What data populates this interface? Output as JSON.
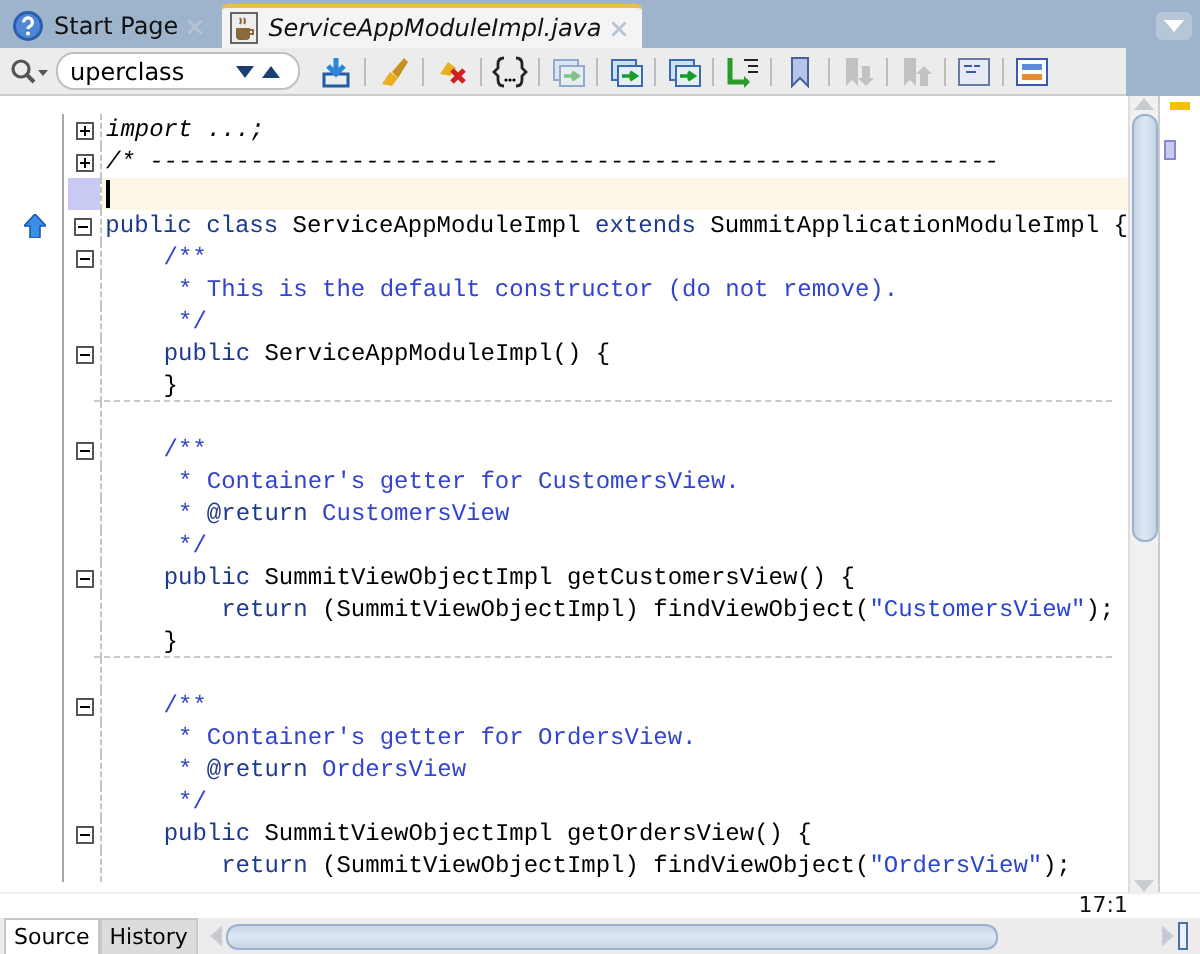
{
  "tabs": [
    {
      "label": "Start Page",
      "selected": false
    },
    {
      "label": "ServiceAppModuleImpl.java",
      "selected": true
    }
  ],
  "toolbar": {
    "search_value": "uperclass",
    "buttons": [
      {
        "disabled": false
      },
      {
        "disabled": false
      },
      {
        "disabled": false
      },
      {
        "disabled": false
      },
      {
        "disabled": true
      },
      {
        "disabled": false
      },
      {
        "disabled": false
      },
      {
        "disabled": false
      },
      {
        "disabled": false
      },
      {
        "disabled": true
      },
      {
        "disabled": true
      },
      {
        "disabled": false
      },
      {
        "disabled": false
      }
    ]
  },
  "code_lines": [
    {
      "kind": "folded",
      "expanded": false,
      "text": "import ...;"
    },
    {
      "kind": "folded",
      "expanded": false,
      "text": "/* -----------------------------------------------------------"
    },
    {
      "current": true
    },
    {
      "kind": "code",
      "expanded": true,
      "overrides": true,
      "text": "**public class** ServiceAppModuleImpl **extends** SummitApplicationModuleImpl {"
    },
    {
      "kind": "comment",
      "expanded": true,
      "text": "    /**"
    },
    {
      "kind": "comment",
      "text": "     * This is the default constructor (do not remove)."
    },
    {
      "kind": "comment",
      "text": "     */"
    },
    {
      "kind": "code",
      "expanded": true,
      "text": "    **public** ServiceAppModuleImpl() {"
    },
    {
      "kind": "code",
      "text": "    }"
    },
    {
      "separator": true
    },
    {
      "kind": "comment",
      "expanded": true,
      "text": "    /**"
    },
    {
      "kind": "comment",
      "text": "     * Container's getter for CustomersView."
    },
    {
      "kind": "comment",
      "text": "     * **@return** CustomersView"
    },
    {
      "kind": "comment",
      "text": "     */"
    },
    {
      "kind": "code",
      "expanded": true,
      "text": "    **public** SummitViewObjectImpl getCustomersView() {"
    },
    {
      "kind": "code",
      "text": "        **return** (SummitViewObjectImpl) findViewObject(*\"CustomersView\"*);"
    },
    {
      "kind": "code",
      "text": "    }"
    },
    {
      "separator": true
    },
    {
      "kind": "comment",
      "expanded": true,
      "text": "    /**"
    },
    {
      "kind": "comment",
      "text": "     * Container's getter for OrdersView."
    },
    {
      "kind": "comment",
      "text": "     * **@return** OrdersView"
    },
    {
      "kind": "comment",
      "text": "     */"
    },
    {
      "kind": "code",
      "expanded": true,
      "text": "    **public** SummitViewObjectImpl getOrdersView() {"
    },
    {
      "kind": "code",
      "text": "        **return** (SummitViewObjectImpl) findViewObject(*\"OrdersView\"*);"
    }
  ],
  "cursor_position": "17:1",
  "bottom_tabs": [
    {
      "label": "Source",
      "selected": true
    },
    {
      "label": "History",
      "selected": false
    }
  ]
}
